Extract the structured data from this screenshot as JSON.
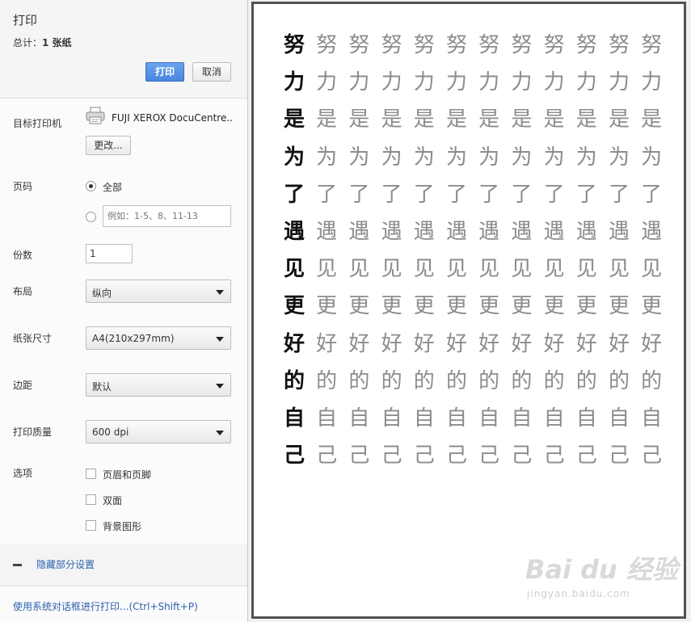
{
  "dialog": {
    "title": "打印",
    "summary_label": "总计：",
    "summary_value": "1 张纸",
    "print_button": "打印",
    "cancel_button": "取消"
  },
  "destination": {
    "label": "目标打印机",
    "printer_name": "FUJI XEROX DocuCentre...",
    "change_button": "更改..."
  },
  "pages": {
    "label": "页码",
    "option_all": "全部",
    "option_all_checked": true,
    "custom_placeholder": "例如：1-5、8、11-13"
  },
  "copies": {
    "label": "份数",
    "value": "1"
  },
  "layout": {
    "label": "布局",
    "value": "纵向"
  },
  "paper_size": {
    "label": "纸张尺寸",
    "value": "A4(210x297mm)"
  },
  "margins": {
    "label": "边距",
    "value": "默认"
  },
  "quality": {
    "label": "打印质量",
    "value": "600 dpi"
  },
  "options": {
    "label": "选项",
    "items": [
      {
        "label": "页眉和页脚",
        "checked": false
      },
      {
        "label": "双面",
        "checked": false
      },
      {
        "label": "背景图形",
        "checked": false
      }
    ]
  },
  "more_settings_link": "隐藏部分设置",
  "system_dialog_link": "使用系统对话框进行打印...(Ctrl+Shift+P)",
  "preview": {
    "characters": [
      "努",
      "力",
      "是",
      "为",
      "了",
      "遇",
      "见",
      "更",
      "好",
      "的",
      "自",
      "己"
    ],
    "columns": 12
  },
  "watermark": {
    "text": "Bai du 经验",
    "sub": "jingyan.baidu.com"
  }
}
